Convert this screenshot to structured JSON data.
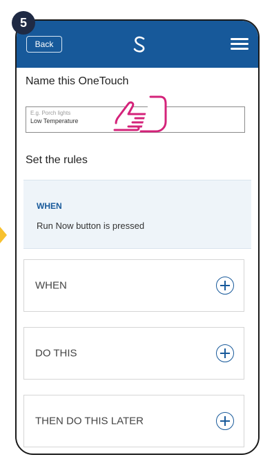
{
  "step_number": "5",
  "header": {
    "back_label": "Back",
    "logo_icon": "swirl-logo-icon",
    "menu_icon": "hamburger-menu-icon",
    "bar_color": "#17599a"
  },
  "name_section": {
    "title": "Name this OneTouch",
    "input_placeholder": "E.g. Porch lights",
    "input_value": "Low Temperature"
  },
  "rules_section": {
    "title": "Set the rules",
    "when_info": {
      "heading": "WHEN",
      "text": "Run Now button is pressed"
    },
    "rule_cards": [
      {
        "label": "WHEN"
      },
      {
        "label": "DO THIS"
      },
      {
        "label": "THEN DO THIS LATER"
      }
    ]
  },
  "colors": {
    "accent": "#17599a",
    "pointer_hand": "#d4237a",
    "side_arrow": "#f7c12f"
  }
}
